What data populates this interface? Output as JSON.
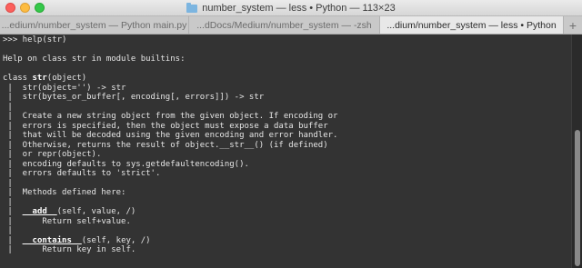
{
  "window": {
    "title": "number_system — less • Python — 113×23",
    "icons": {
      "folder": "folder-icon"
    },
    "colors": {
      "close": "#fc605c",
      "minimize": "#fdbc40",
      "maximize": "#34c84a",
      "terminal_bg": "#333333",
      "terminal_fg": "#e6e6e6"
    }
  },
  "tabs": [
    {
      "label": "...edium/number_system — Python main.py",
      "active": false
    },
    {
      "label": "...dDocs/Medium/number_system — -zsh",
      "active": false
    },
    {
      "label": "...dium/number_system — less • Python",
      "active": true
    }
  ],
  "new_tab_label": "+",
  "terminal": {
    "lines": [
      [
        {
          "t": ">>> help(str)"
        }
      ],
      [
        {
          "t": ""
        }
      ],
      [
        {
          "t": "Help on class str in module builtins:"
        }
      ],
      [
        {
          "t": ""
        }
      ],
      [
        {
          "t": "class "
        },
        {
          "t": "str",
          "s": "bold"
        },
        {
          "t": "(object)"
        }
      ],
      [
        {
          "t": " |  str(object='') -> str"
        }
      ],
      [
        {
          "t": " |  str(bytes_or_buffer[, encoding[, errors]]) -> str"
        }
      ],
      [
        {
          "t": " |"
        }
      ],
      [
        {
          "t": " |  Create a new string object from the given object. If encoding or"
        }
      ],
      [
        {
          "t": " |  errors is specified, then the object must expose a data buffer"
        }
      ],
      [
        {
          "t": " |  that will be decoded using the given encoding and error handler."
        }
      ],
      [
        {
          "t": " |  Otherwise, returns the result of object.__str__() (if defined)"
        }
      ],
      [
        {
          "t": " |  or repr(object)."
        }
      ],
      [
        {
          "t": " |  encoding defaults to sys.getdefaultencoding()."
        }
      ],
      [
        {
          "t": " |  errors defaults to 'strict'."
        }
      ],
      [
        {
          "t": " |"
        }
      ],
      [
        {
          "t": " |  Methods defined here:"
        }
      ],
      [
        {
          "t": " |"
        }
      ],
      [
        {
          "t": " |  "
        },
        {
          "t": "__add__",
          "s": "ul"
        },
        {
          "t": "(self, value, /)"
        }
      ],
      [
        {
          "t": " |      Return self+value."
        }
      ],
      [
        {
          "t": " |"
        }
      ],
      [
        {
          "t": " |  "
        },
        {
          "t": "__contains__",
          "s": "ul"
        },
        {
          "t": "(self, key, /)"
        }
      ],
      [
        {
          "t": " |      Return key in self."
        }
      ]
    ]
  }
}
